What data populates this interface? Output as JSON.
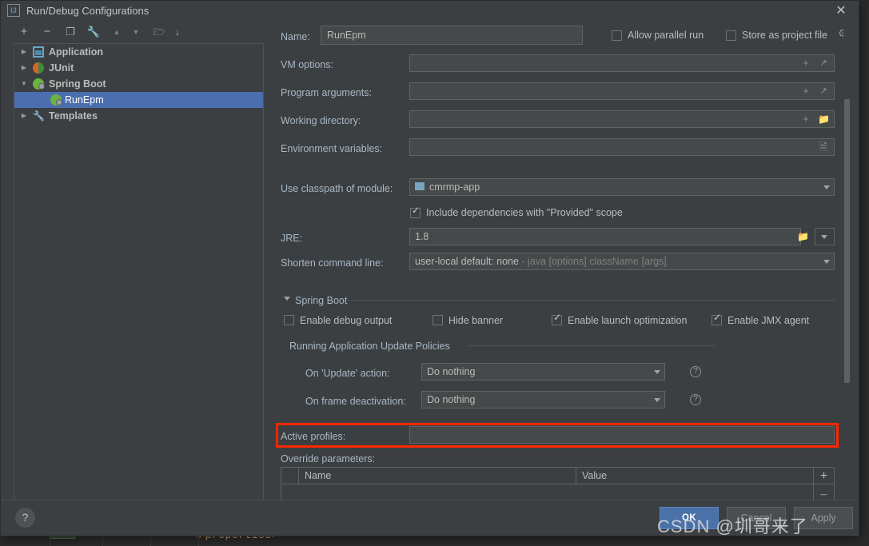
{
  "window": {
    "title": "Run/Debug Configurations",
    "app_icon": "intellij-idea-icon",
    "close_label": "✕"
  },
  "toolbar": {
    "items": [
      {
        "name": "add-configuration-button",
        "glyph": "+"
      },
      {
        "name": "remove-configuration-button",
        "glyph": "−"
      },
      {
        "name": "copy-configuration-button",
        "glyph": "❐"
      },
      {
        "name": "edit-templates-button",
        "glyph": "🔧"
      },
      {
        "name": "move-up-button",
        "glyph": "▲"
      },
      {
        "name": "move-down-button",
        "glyph": "▼"
      },
      {
        "name": "new-folder-button",
        "glyph": "🗁"
      },
      {
        "name": "sort-configurations-button",
        "glyph": "↓"
      }
    ]
  },
  "tree": {
    "items": [
      {
        "label": "Application",
        "icon": "application-icon",
        "expandable": true,
        "expanded": false,
        "depth": 0,
        "selected": false
      },
      {
        "label": "JUnit",
        "icon": "junit-icon",
        "expandable": true,
        "expanded": false,
        "depth": 0,
        "selected": false
      },
      {
        "label": "Spring Boot",
        "icon": "spring-boot-icon",
        "expandable": true,
        "expanded": true,
        "depth": 0,
        "selected": false
      },
      {
        "label": "RunEpm",
        "icon": "spring-boot-icon",
        "expandable": false,
        "expanded": false,
        "depth": 1,
        "selected": true
      },
      {
        "label": "Templates",
        "icon": "wrench-icon",
        "expandable": true,
        "expanded": false,
        "depth": 0,
        "selected": false
      }
    ]
  },
  "form": {
    "name_label": "Name:",
    "name_value": "RunEpm",
    "allow_parallel_run": {
      "label": "Allow parallel run",
      "checked": false
    },
    "store_as_project_file": {
      "label": "Store as project file",
      "checked": false
    },
    "vm_options": {
      "label": "VM options:",
      "value": ""
    },
    "program_arguments": {
      "label": "Program arguments:",
      "value": ""
    },
    "working_directory": {
      "label": "Working directory:",
      "value": ""
    },
    "environment_variables": {
      "label": "Environment variables:",
      "value": ""
    },
    "use_classpath_of_module": {
      "label": "Use classpath of module:",
      "value": "cmrmp-app"
    },
    "include_provided": {
      "label": "Include dependencies with \"Provided\" scope",
      "checked": true
    },
    "jre": {
      "label": "JRE:",
      "value": "1.8"
    },
    "shorten_command_line": {
      "label": "Shorten command line:",
      "value": "user-local default: none",
      "value_hint": " - java [options] className [args]"
    }
  },
  "spring_boot": {
    "section_title": "Spring Boot",
    "enable_debug_output": {
      "label": "Enable debug output",
      "checked": false
    },
    "hide_banner": {
      "label": "Hide banner",
      "checked": false
    },
    "enable_launch_optimization": {
      "label": "Enable launch optimization",
      "checked": true
    },
    "enable_jmx_agent": {
      "label": "Enable JMX agent",
      "checked": true
    },
    "update_policies_title": "Running Application Update Policies",
    "on_update_action": {
      "label": "On 'Update' action:",
      "value": "Do nothing",
      "help": "?"
    },
    "on_frame_deactivation": {
      "label": "On frame deactivation:",
      "value": "Do nothing",
      "help": "?"
    },
    "active_profiles": {
      "label": "Active profiles:",
      "value": "",
      "highlight_color": "#ff2600"
    },
    "override_parameters": {
      "label": "Override parameters:",
      "columns": [
        "Name",
        "Value"
      ],
      "rows": [],
      "add_button": "+",
      "remove_button": "−"
    }
  },
  "footer": {
    "help_button": "?",
    "ok_label": "OK",
    "cancel_label": "Cancel",
    "apply_label": "Apply"
  },
  "background": {
    "code_line": "</properties>"
  },
  "watermark": "CSDN @圳哥来了"
}
